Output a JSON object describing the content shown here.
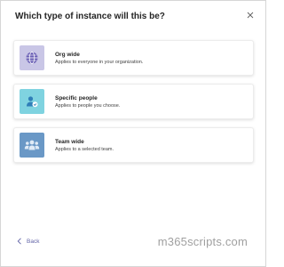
{
  "dialog": {
    "title": "Which type of instance will this be?"
  },
  "options": [
    {
      "title": "Org wide",
      "description": "Applies to everyone in your organization.",
      "icon": "globe-icon",
      "icon_bg": "#c9c6e6"
    },
    {
      "title": "Specific people",
      "description": "Applies to people you choose.",
      "icon": "person-check-icon",
      "icon_bg": "#7fd3e0"
    },
    {
      "title": "Team wide",
      "description": "Applies to a selected team.",
      "icon": "team-icon",
      "icon_bg": "#6a98c6"
    }
  ],
  "footer": {
    "back_label": "Back",
    "watermark": "m365scripts.com"
  },
  "colors": {
    "accent": "#6264a7"
  }
}
